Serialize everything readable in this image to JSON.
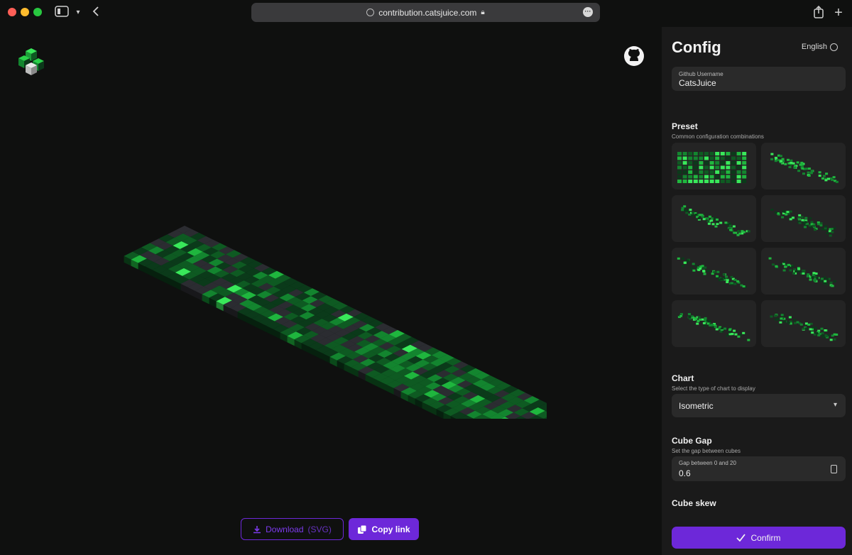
{
  "browser": {
    "url": "contribution.catsjuice.com"
  },
  "toolbar": {
    "download_label": "Download",
    "download_format": "(SVG)",
    "copy_label": "Copy link"
  },
  "sidebar": {
    "title": "Config",
    "language": "English",
    "username": {
      "label": "Github Username",
      "value": "CatsJuice"
    },
    "preset": {
      "title": "Preset",
      "subtitle": "Common configuration combinations"
    },
    "chart": {
      "title": "Chart",
      "subtitle": "Select the type of chart to display",
      "value": "Isometric"
    },
    "cube_gap": {
      "title": "Cube Gap",
      "subtitle": "Set the gap between cubes",
      "label": "Gap between 0 and 20",
      "value": "0.6"
    },
    "cube_skew": {
      "title": "Cube skew"
    },
    "confirm_label": "Confirm"
  },
  "colors": {
    "accent": "#6d28d9",
    "background": "#0f100f",
    "panel": "#1a1a1a",
    "levels": [
      "#2b2c31",
      "#0b3a1a",
      "#0e5a22",
      "#13852f",
      "#1fb63e",
      "#39e85a"
    ]
  },
  "chart_data": {
    "type": "heatmap",
    "style": "isometric",
    "rows": 7,
    "weeks": 53,
    "level_scale": [
      0,
      1,
      2,
      3,
      4,
      5
    ]
  }
}
